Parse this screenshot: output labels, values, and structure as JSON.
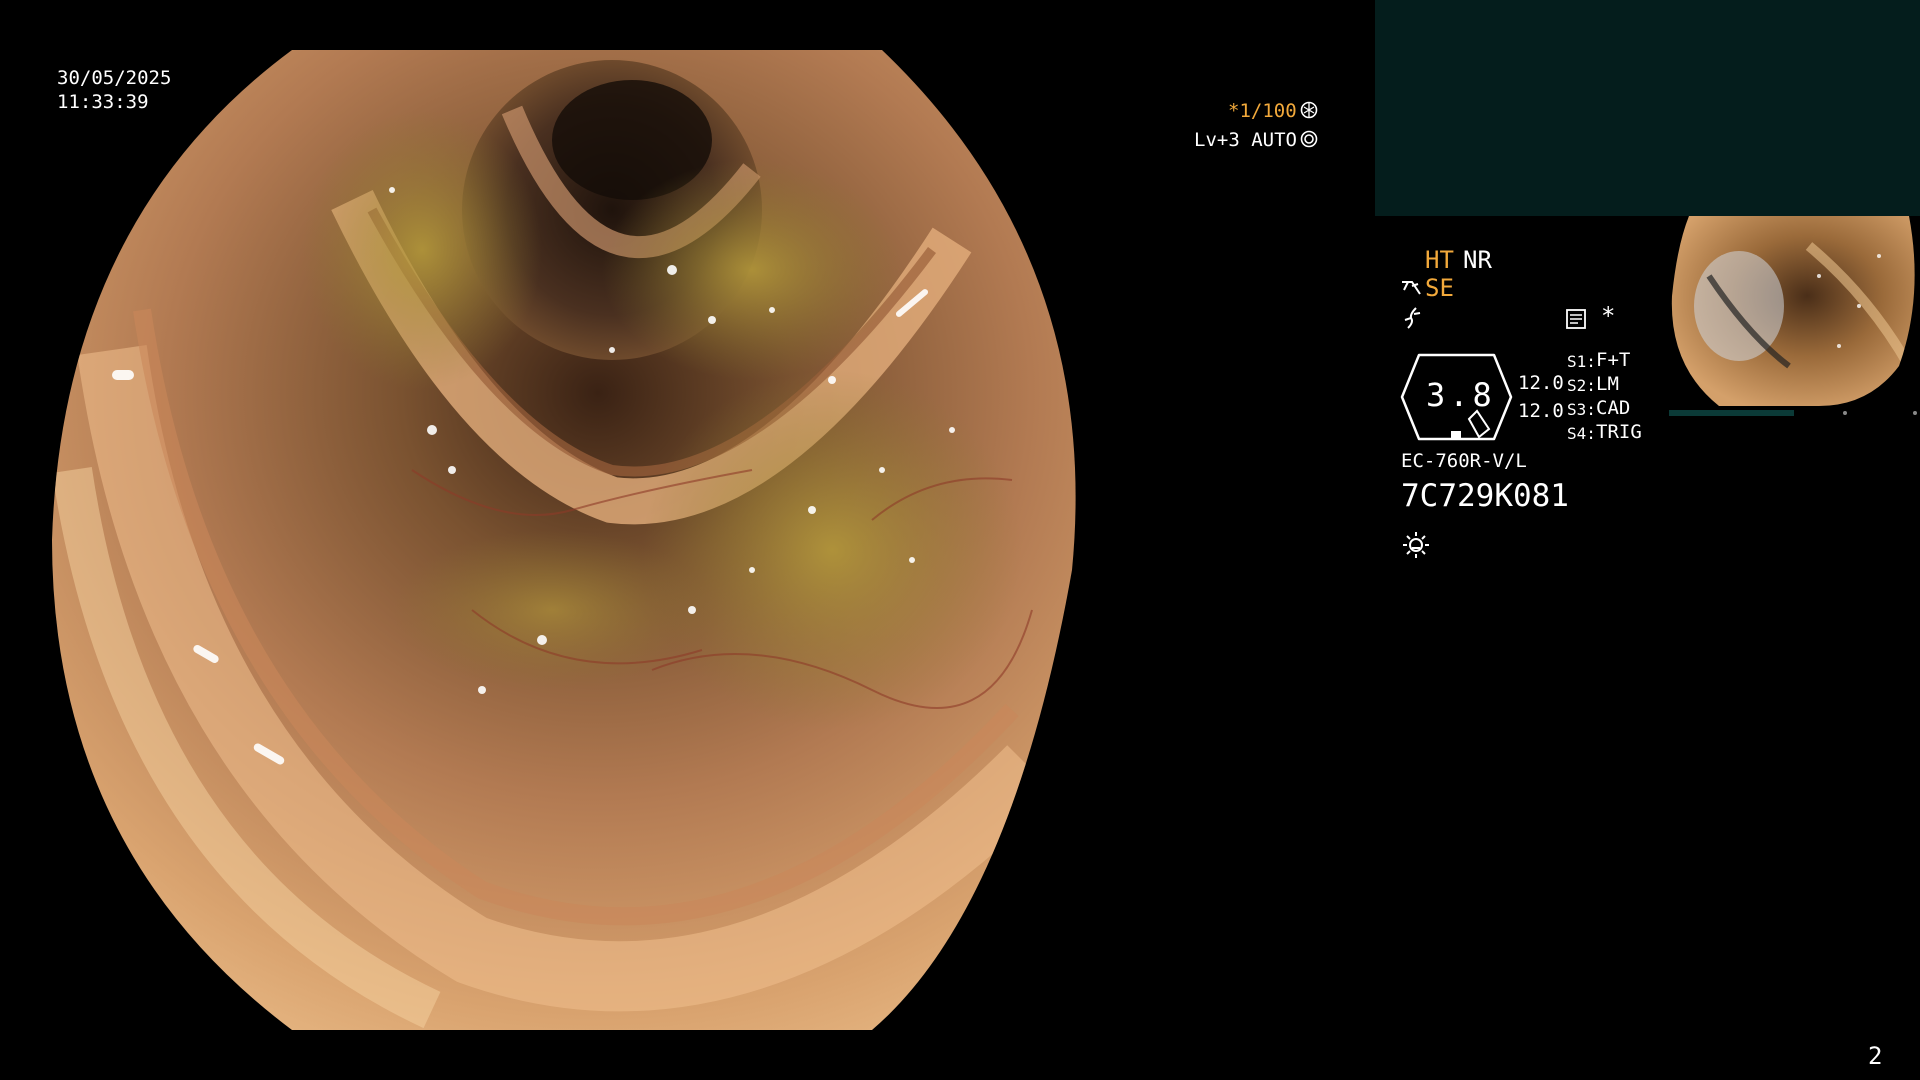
{
  "datetime": {
    "date": "30/05/2025",
    "time": "11:33:39"
  },
  "exposure": {
    "shutter": "*1/100",
    "level": "Lv+3 AUTO"
  },
  "enhancement": {
    "ht": "HT",
    "nr": "NR",
    "se": "SE"
  },
  "magnification": {
    "value": "3.8",
    "lens_a": "12.0",
    "lens_b": "12.0"
  },
  "switches": [
    {
      "key": "S1:",
      "value": "F+T"
    },
    {
      "key": "S2:",
      "value": "LM"
    },
    {
      "key": "S3:",
      "value": "CAD"
    },
    {
      "key": "S4:",
      "value": "TRIG"
    }
  ],
  "scope": {
    "model": "EC-760R-V/L",
    "serial": "7C729K081"
  },
  "indicators": {
    "star": "*"
  },
  "page_number": "2",
  "colors": {
    "accent_orange": "#f2a93b",
    "aux_box": "#041d1c",
    "background": "#000000"
  },
  "icons": [
    "shutter-mode-icon",
    "auto-iris-icon",
    "structure-enhancement-icon",
    "flash-icon",
    "memo-icon",
    "light-source-icon"
  ]
}
